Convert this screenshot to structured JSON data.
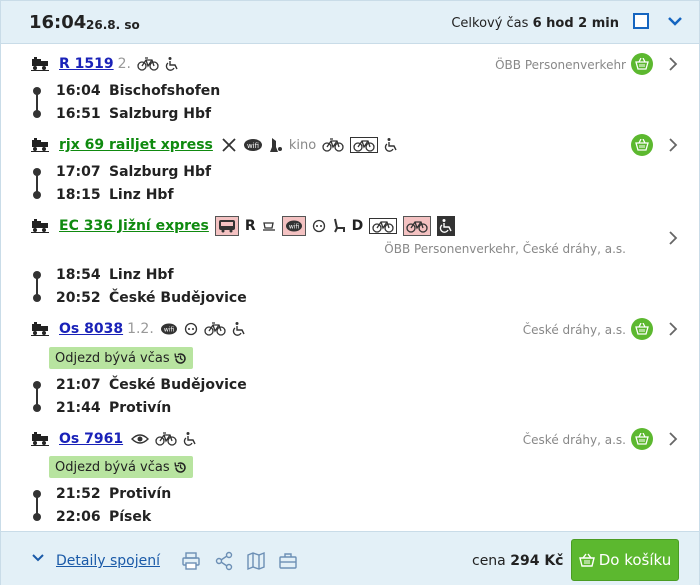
{
  "header": {
    "time": "16:04",
    "date": "26.8. so",
    "total_prefix": "Celkový čas",
    "total_value": "6 hod 2 min"
  },
  "segments": [
    {
      "train": "R 1519",
      "class": "2.",
      "amenities": [
        "bike-icon",
        "wheelchair-icon"
      ],
      "carrier": "ÖBB Personenverkehr",
      "stops": [
        {
          "time": "16:04",
          "station": "Bischofshofen"
        },
        {
          "time": "16:51",
          "station": "Salzburg Hbf"
        }
      ]
    },
    {
      "train": "rjx 69 railjet xpress",
      "amenities": [
        "restaurant-icon",
        "wifi-icon",
        "cleaning-icon",
        "kino",
        "bike-icon",
        "bike-reservation-icon",
        "wheelchair-icon"
      ],
      "kino_label": "kino",
      "stops": [
        {
          "time": "17:07",
          "station": "Salzburg Hbf"
        },
        {
          "time": "18:15",
          "station": "Linz Hbf"
        }
      ]
    },
    {
      "train": "EC 336 Jižní expres",
      "amenities": [
        "bus-icon",
        "R",
        "bistro-icon",
        "wifi-icon",
        "socket-icon",
        "seat-icon",
        "D",
        "bike-reservation-icon",
        "bike-icon",
        "wheelchair-icon"
      ],
      "letter_r": "R",
      "letter_d": "D",
      "carrier": "ÖBB Personenverkehr, České dráhy, a.s.",
      "stops": [
        {
          "time": "18:54",
          "station": "Linz Hbf"
        },
        {
          "time": "20:52",
          "station": "České Budějovice"
        }
      ]
    },
    {
      "train": "Os 8038",
      "class": "1.2.",
      "amenities": [
        "wifi-icon",
        "socket-icon",
        "bike-icon",
        "wheelchair-icon"
      ],
      "carrier": "České dráhy, a.s.",
      "badge": "Odjezd bývá včas",
      "stops": [
        {
          "time": "21:07",
          "station": "České Budějovice"
        },
        {
          "time": "21:44",
          "station": "Protivín"
        }
      ]
    },
    {
      "train": "Os 7961",
      "amenities": [
        "eye-icon",
        "bike-icon",
        "wheelchair-icon"
      ],
      "carrier": "České dráhy, a.s.",
      "badge": "Odjezd bývá včas",
      "stops": [
        {
          "time": "21:52",
          "station": "Protivín"
        },
        {
          "time": "22:06",
          "station": "Písek"
        }
      ]
    }
  ],
  "footer": {
    "details_label": "Detaily spojení",
    "price_label": "cena",
    "price_value": "294 Kč",
    "cart_button": "Do košíku"
  },
  "colors": {
    "accent": "#1a22b8",
    "railjet": "#0f8a0f",
    "basket": "#5cb82f",
    "header_bg": "#e3f0f7",
    "badge_bg": "#b8e4a0"
  }
}
